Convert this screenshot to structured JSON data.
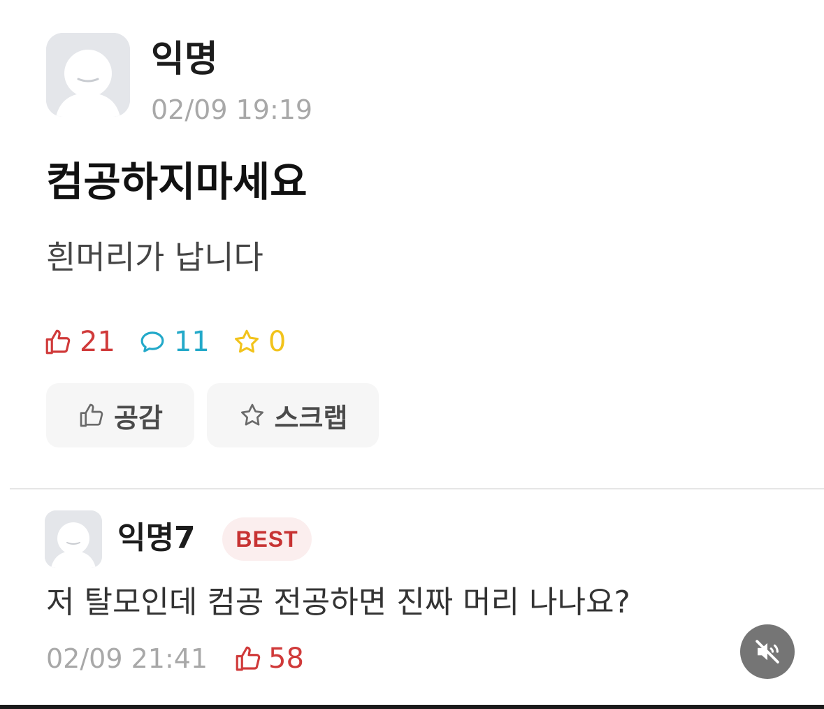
{
  "post": {
    "author": "익명",
    "time": "02/09 19:19",
    "title": "컴공하지마세요",
    "body": "흰머리가 납니다",
    "like_count": "21",
    "comment_count": "11",
    "scrap_count": "0",
    "like_button_label": "공감",
    "scrap_button_label": "스크랩"
  },
  "comment": {
    "author": "익명7",
    "badge": "BEST",
    "text": "저 탈모인데 컴공 전공하면 진짜 머리 나나요?",
    "time": "02/09 21:41",
    "like_count": "58"
  },
  "colors": {
    "like": "#d03a3a",
    "comment": "#23a9c9",
    "scrap": "#f2c31b",
    "best_badge_text": "#c73232",
    "best_badge_bg": "#fbeeee"
  },
  "icons": {
    "avatar": "default-profile-icon",
    "like": "thumbs-up-icon",
    "comment": "speech-bubble-icon",
    "scrap": "star-icon",
    "mute": "muted-speaker-icon"
  }
}
